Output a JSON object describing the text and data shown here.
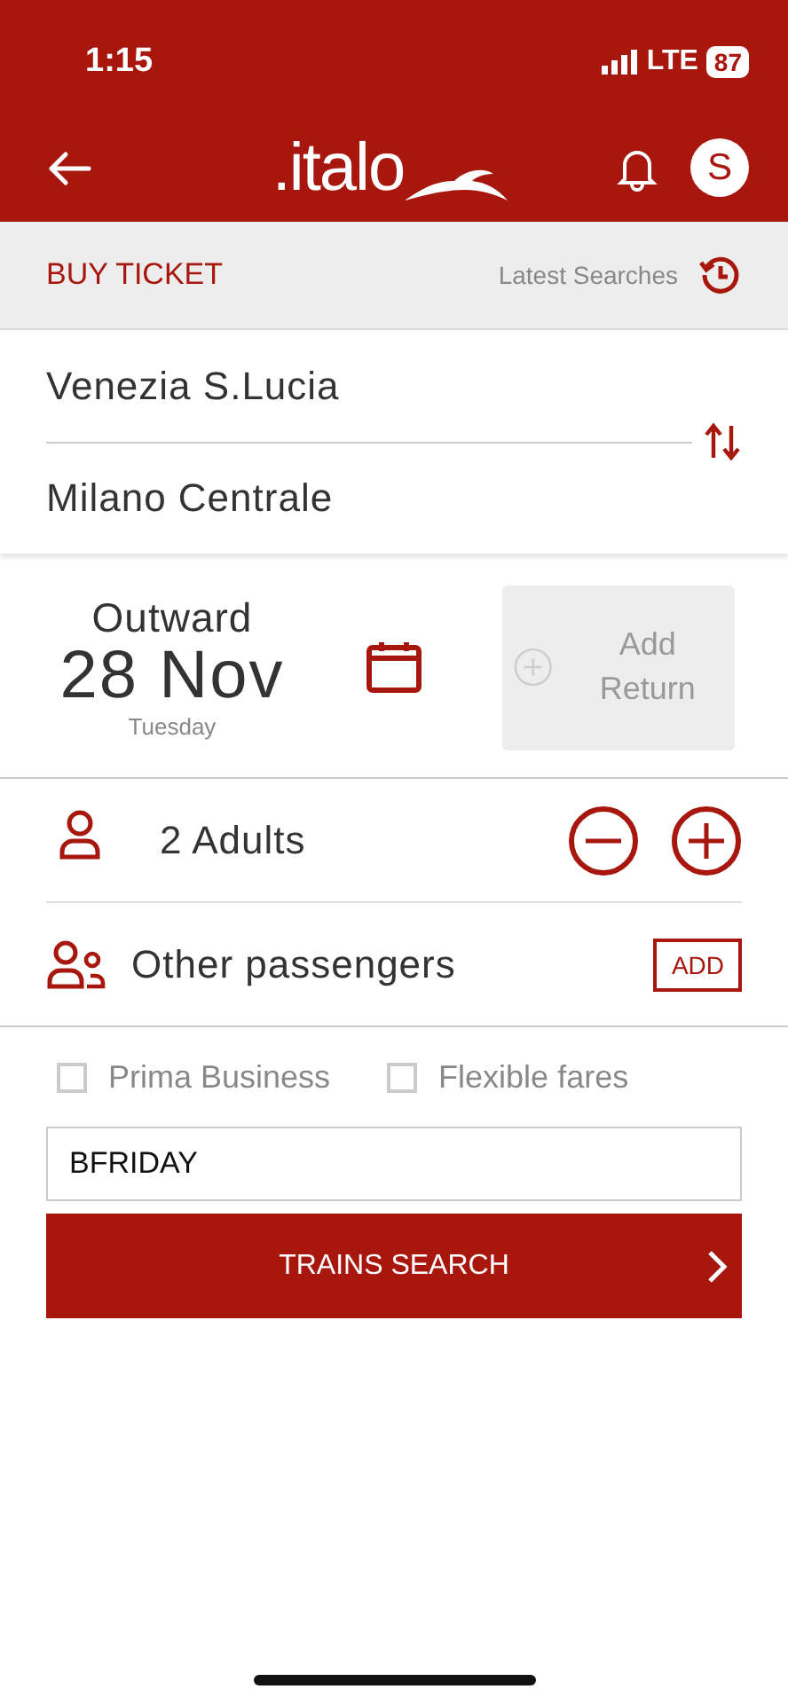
{
  "status_bar": {
    "time": "1:15",
    "network": "LTE",
    "battery": "87"
  },
  "header": {
    "logo": ".italo",
    "avatar": "S"
  },
  "toolbar": {
    "title": "BUY TICKET",
    "latest_searches": "Latest Searches"
  },
  "route": {
    "from": "Venezia S.Lucia",
    "to": "Milano Centrale"
  },
  "outward": {
    "label": "Outward",
    "date": "28 Nov",
    "weekday": "Tuesday"
  },
  "return": {
    "label": "Add Return",
    "disabled": true
  },
  "adults": {
    "label": "2 Adults"
  },
  "other_passengers": {
    "label": "Other passengers",
    "button": "ADD"
  },
  "options": [
    {
      "label": "Prima Business",
      "checked": false
    },
    {
      "label": "Flexible fares",
      "checked": false
    }
  ],
  "promo_code": {
    "value": "BFRIDAY"
  },
  "search_button": {
    "label": "TRAINS SEARCH"
  }
}
